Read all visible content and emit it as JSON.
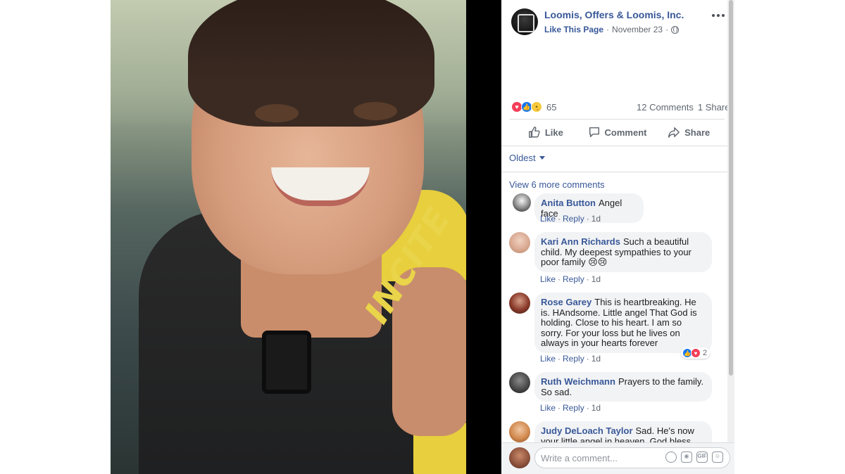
{
  "post": {
    "page_name": "Loomis, Offers & Loomis, Inc.",
    "like_page": "Like This Page",
    "date": "November 23",
    "dot": "·",
    "reaction_count": "65",
    "comments_count": "12 Comments",
    "shares_count": "1 Share"
  },
  "photo": {
    "vest_brand": "INCITE"
  },
  "actions": {
    "like": "Like",
    "comment": "Comment",
    "share": "Share"
  },
  "comments_section": {
    "sort_label": "Oldest",
    "view_more": "View 6 more comments",
    "action_like": "Like",
    "action_reply": "Reply",
    "time": "1d",
    "items": [
      {
        "author": "Anita Button",
        "text": "Angel face"
      },
      {
        "author": "Kari Ann Richards",
        "text": "Such a beautiful child. My deepest sympathies to your poor family 😢😢"
      },
      {
        "author": "Rose Garey",
        "text": "This is heartbreaking. He is. HAndsome. Little angel That God is holding. Close to his heart. I am so sorry. For your loss but he lives on always in your hearts forever",
        "reaction_count": "2"
      },
      {
        "author": "Ruth Weichmann",
        "text": "Prayers to the family. So sad."
      },
      {
        "author": "Judy DeLoach Taylor",
        "text": "Sad. He's now your little angel in heaven. God bless you"
      }
    ]
  },
  "compose": {
    "placeholder": "Write a comment...",
    "gif": "GIF"
  }
}
